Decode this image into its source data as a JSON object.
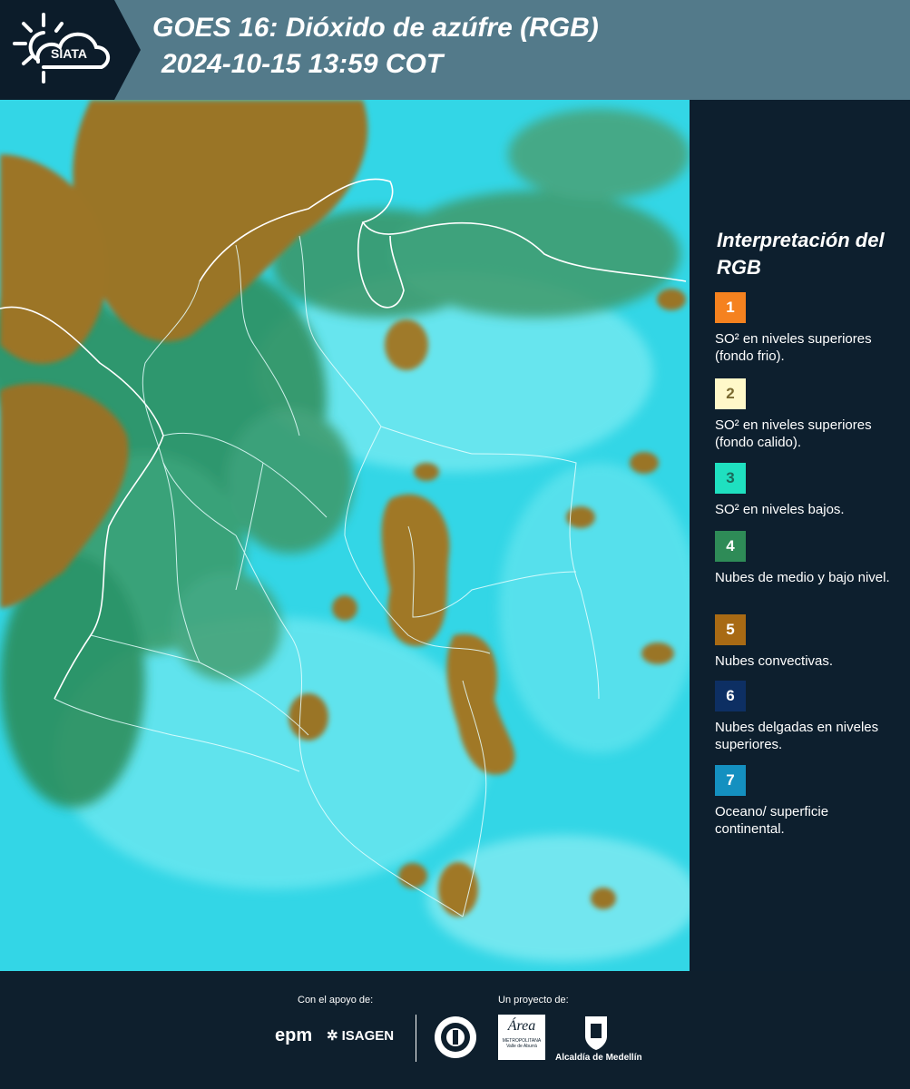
{
  "header": {
    "logo_text": "SIATA",
    "title_line1": "GOES 16: Dióxido de azúfre (RGB)",
    "title_line2": "2024-10-15 13:59 COT"
  },
  "legend": {
    "title": "Interpretación del RGB",
    "items": [
      {
        "num": "1",
        "text": "SO² en niveles superiores (fondo frio).",
        "color": "#f5821f"
      },
      {
        "num": "2",
        "text": "SO² en niveles superiores (fondo calido).",
        "color": "#fff8c9"
      },
      {
        "num": "3",
        "text": "SO² en niveles bajos.",
        "color": "#1fe0c0"
      },
      {
        "num": "4",
        "text": "Nubes de medio y bajo nivel.",
        "color": "#2e8b57"
      },
      {
        "num": "5",
        "text": "Nubes convectivas.",
        "color": "#a86a14"
      },
      {
        "num": "6",
        "text": "Nubes delgadas en niveles superiores.",
        "color": "#0d2f63"
      },
      {
        "num": "7",
        "text": "Oceano/ superficie continental.",
        "color": "#1490c0"
      }
    ]
  },
  "footer": {
    "support_label": "Con el apoyo de:",
    "project_label": "Un proyecto de:",
    "epm": "epm",
    "isagen": "ISAGEN",
    "area_logo_text": "Área",
    "area_sub1": "METROPOLITANA",
    "area_sub2": "Valle de Aburrá",
    "alcaldia": "Alcaldía de Medellín"
  },
  "colors": {
    "header_band": "#537a8a",
    "cyan_ground": "#2de0ea",
    "convective": "#9a7426",
    "mid_cloud": "#2b8a55"
  }
}
